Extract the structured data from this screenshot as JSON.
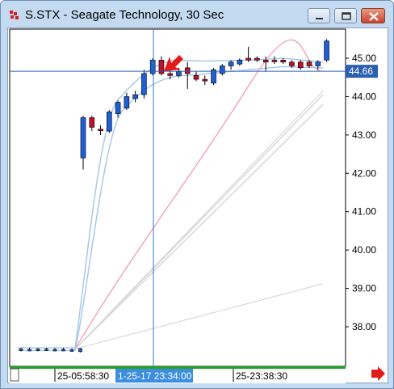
{
  "window": {
    "title": "S.STX - Seagate Technology, 30 Sec",
    "minimize_icon": "minimize-icon",
    "maximize_icon": "maximize-icon",
    "close_icon": "close-icon"
  },
  "colors": {
    "bull_candle": "#1f5fd6",
    "bear_candle": "#c0102a",
    "band_line": "#a9c9ea",
    "pink_line": "#f08aa8",
    "gray_line": "#d9d9d9",
    "crosshair": "#2b7cc6",
    "price_line": "#2b5fb0",
    "cursor_arrow": "#e11a1a",
    "scrollbar": "#22a622",
    "time_highlight": "#3b8ee0"
  },
  "chart_data": {
    "type": "candlestick",
    "y_axis_ticks": [
      "45.00",
      "44.00",
      "43.00",
      "42.00",
      "41.00",
      "40.00",
      "39.00",
      "38.00"
    ],
    "ylim": [
      37.3,
      45.6
    ],
    "current_price": "44.66",
    "time_labels": [
      "25-05:58:30",
      "1-25-17 23:34:00",
      "25-23:38:30"
    ],
    "highlighted_time": "1-25-17 23:34:00",
    "candles": [
      {
        "o": 37.4,
        "h": 37.45,
        "l": 37.36,
        "c": 37.42,
        "dir": "flat"
      },
      {
        "o": 37.41,
        "h": 37.45,
        "l": 37.37,
        "c": 37.4,
        "dir": "flat"
      },
      {
        "o": 37.4,
        "h": 37.44,
        "l": 37.36,
        "c": 37.42,
        "dir": "flat"
      },
      {
        "o": 37.42,
        "h": 37.45,
        "l": 37.37,
        "c": 37.4,
        "dir": "flat"
      },
      {
        "o": 37.4,
        "h": 37.44,
        "l": 37.36,
        "c": 37.41,
        "dir": "flat"
      },
      {
        "o": 37.41,
        "h": 37.45,
        "l": 37.37,
        "c": 37.39,
        "dir": "flat"
      },
      {
        "o": 37.39,
        "h": 37.43,
        "l": 37.35,
        "c": 37.4,
        "dir": "flat"
      },
      {
        "o": 37.35,
        "h": 37.44,
        "l": 37.33,
        "c": 37.43,
        "dir": "up"
      },
      {
        "o": 42.4,
        "h": 43.5,
        "l": 42.1,
        "c": 43.45,
        "dir": "up"
      },
      {
        "o": 43.45,
        "h": 43.5,
        "l": 43.1,
        "c": 43.2,
        "dir": "down"
      },
      {
        "o": 43.15,
        "h": 43.25,
        "l": 43.0,
        "c": 43.15,
        "dir": "down"
      },
      {
        "o": 43.1,
        "h": 43.65,
        "l": 43.05,
        "c": 43.6,
        "dir": "up"
      },
      {
        "o": 43.55,
        "h": 43.9,
        "l": 43.45,
        "c": 43.85,
        "dir": "up"
      },
      {
        "o": 43.7,
        "h": 44.1,
        "l": 43.65,
        "c": 44.0,
        "dir": "up"
      },
      {
        "o": 43.95,
        "h": 44.15,
        "l": 43.85,
        "c": 44.05,
        "dir": "up"
      },
      {
        "o": 44.05,
        "h": 44.7,
        "l": 43.95,
        "c": 44.6,
        "dir": "up"
      },
      {
        "o": 44.6,
        "h": 45.0,
        "l": 44.55,
        "c": 44.95,
        "dir": "up"
      },
      {
        "o": 44.95,
        "h": 45.05,
        "l": 44.55,
        "c": 44.6,
        "dir": "down"
      },
      {
        "o": 44.6,
        "h": 44.75,
        "l": 44.45,
        "c": 44.55,
        "dir": "down"
      },
      {
        "o": 44.55,
        "h": 44.75,
        "l": 44.5,
        "c": 44.65,
        "dir": "up"
      },
      {
        "o": 44.6,
        "h": 44.9,
        "l": 44.2,
        "c": 44.75,
        "dir": "down"
      },
      {
        "o": 44.55,
        "h": 44.65,
        "l": 44.4,
        "c": 44.45,
        "dir": "down"
      },
      {
        "o": 44.45,
        "h": 44.55,
        "l": 44.3,
        "c": 44.45,
        "dir": "flat"
      },
      {
        "o": 44.35,
        "h": 44.75,
        "l": 44.3,
        "c": 44.7,
        "dir": "up"
      },
      {
        "o": 44.6,
        "h": 44.85,
        "l": 44.55,
        "c": 44.8,
        "dir": "up"
      },
      {
        "o": 44.8,
        "h": 44.95,
        "l": 44.7,
        "c": 44.9,
        "dir": "up"
      },
      {
        "o": 44.85,
        "h": 45.0,
        "l": 44.8,
        "c": 44.95,
        "dir": "up"
      },
      {
        "o": 44.95,
        "h": 45.3,
        "l": 44.9,
        "c": 45.0,
        "dir": "down"
      },
      {
        "o": 45.0,
        "h": 45.05,
        "l": 44.9,
        "c": 44.95,
        "dir": "flat"
      },
      {
        "o": 44.9,
        "h": 45.05,
        "l": 44.65,
        "c": 44.95,
        "dir": "down"
      },
      {
        "o": 44.95,
        "h": 45.05,
        "l": 44.85,
        "c": 44.95,
        "dir": "flat"
      },
      {
        "o": 44.95,
        "h": 45.0,
        "l": 44.85,
        "c": 44.9,
        "dir": "down"
      },
      {
        "o": 44.9,
        "h": 44.95,
        "l": 44.75,
        "c": 44.8,
        "dir": "down"
      },
      {
        "o": 44.75,
        "h": 44.95,
        "l": 44.7,
        "c": 44.9,
        "dir": "down"
      },
      {
        "o": 44.9,
        "h": 44.95,
        "l": 44.75,
        "c": 44.8,
        "dir": "down"
      },
      {
        "o": 44.8,
        "h": 44.95,
        "l": 44.7,
        "c": 44.9,
        "dir": "up"
      },
      {
        "o": 44.95,
        "h": 45.5,
        "l": 44.9,
        "c": 45.45,
        "dir": "up"
      }
    ]
  }
}
